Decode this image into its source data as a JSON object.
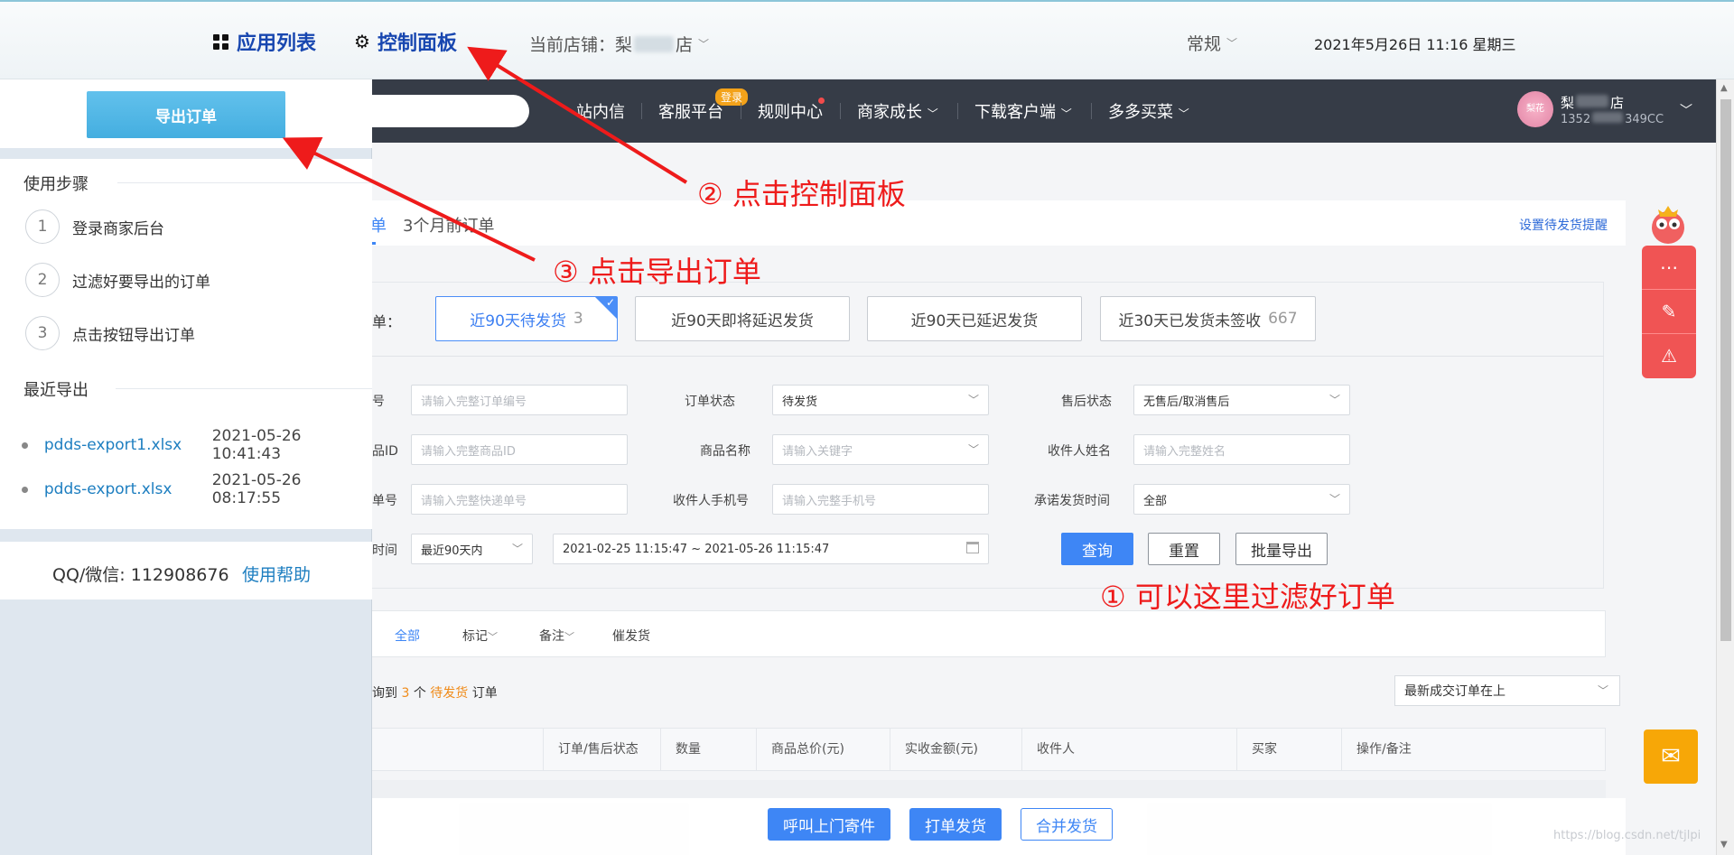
{
  "topbar": {
    "app_list": "应用列表",
    "control_panel": "控制面板",
    "store_prefix": "当前店铺：梨",
    "store_suffix": "店",
    "mode": "常规",
    "datetime": "2021年5月26日 11:16 星期三"
  },
  "header": {
    "nav": [
      "站内信",
      "客服平台",
      "规则中心",
      "商家成长",
      "下载客户端",
      "多多买菜"
    ],
    "login_badge": "登录",
    "user_name": "梨",
    "user_name_end": "店",
    "user_phone": "1352",
    "user_phone_end": "349CC",
    "avatar_text": "梨花"
  },
  "tabs": {
    "active_fragment": "单",
    "three_month": "3个月前订单",
    "set_reminder": "设置待发货提醒"
  },
  "quick": {
    "label": "单：",
    "buttons": [
      {
        "label": "近90天待发货",
        "count": "3"
      },
      {
        "label": "近90天即将延迟发货",
        "count": ""
      },
      {
        "label": "近90天已延迟发货",
        "count": ""
      },
      {
        "label": "近30天已发货未签收",
        "count": "667"
      }
    ]
  },
  "filters": {
    "order_no_label": "号",
    "order_no_ph": "请输入完整订单编号",
    "order_status_label": "订单状态",
    "order_status_value": "待发货",
    "after_sale_label": "售后状态",
    "after_sale_value": "无售后/取消售后",
    "goods_id_label": "品ID",
    "goods_id_ph": "请输入完整商品ID",
    "goods_name_label": "商品名称",
    "goods_name_ph": "请输入关键字",
    "receiver_name_label": "收件人姓名",
    "receiver_name_ph": "请输入完整姓名",
    "express_label": "单号",
    "express_ph": "请输入完整快递单号",
    "receiver_phone_label": "收件人手机号",
    "receiver_phone_ph": "请输入完整手机号",
    "promise_label": "承诺发货时间",
    "promise_value": "全部",
    "time_label": "时间",
    "time_range_value": "最近90天内",
    "date_range": "2021-02-25 11:15:47 ~ 2021-05-26 11:15:47",
    "query": "查询",
    "reset": "重置",
    "batch_export": "批量导出"
  },
  "listbar": {
    "all": "全部",
    "mark": "标记",
    "note": "备注",
    "urge": "催发货"
  },
  "found": {
    "prefix": "询到",
    "count": "3",
    "mid": "个",
    "status": "待发货",
    "suffix": "订单"
  },
  "sort": "最新成交订单在上",
  "table_headers": [
    "订单/售后状态",
    "数量",
    "商品总价(元)",
    "实收金额(元)",
    "收件人",
    "买家",
    "操作/备注"
  ],
  "bottom_buttons": [
    "呼叫上门寄件",
    "打单发货",
    "合并发货"
  ],
  "annotations": {
    "a1": "① 可以这里过滤好订单",
    "a2": "② 点击控制面板",
    "a3": "③ 点击导出订单"
  },
  "panel": {
    "export_button": "导出订单",
    "steps_title": "使用步骤",
    "steps": [
      {
        "num": "1",
        "text": "登录商家后台"
      },
      {
        "num": "2",
        "text": "过滤好要导出的订单"
      },
      {
        "num": "3",
        "text": "点击按钮导出订单"
      }
    ],
    "recent_title": "最近导出",
    "exports": [
      {
        "file": "pdds-export1.xlsx",
        "time": "2021-05-26 10:41:43"
      },
      {
        "file": "pdds-export.xlsx",
        "time": "2021-05-26 08:17:55"
      }
    ],
    "contact": "QQ/微信: 112908676",
    "help": "使用帮助"
  },
  "watermark": "https://blog.csdn.net/tjlpi",
  "colors": {
    "accent": "#3e86f5",
    "annotation": "#ee1b1b",
    "panel_button": "#4ab2e3",
    "header": "#363c47"
  }
}
